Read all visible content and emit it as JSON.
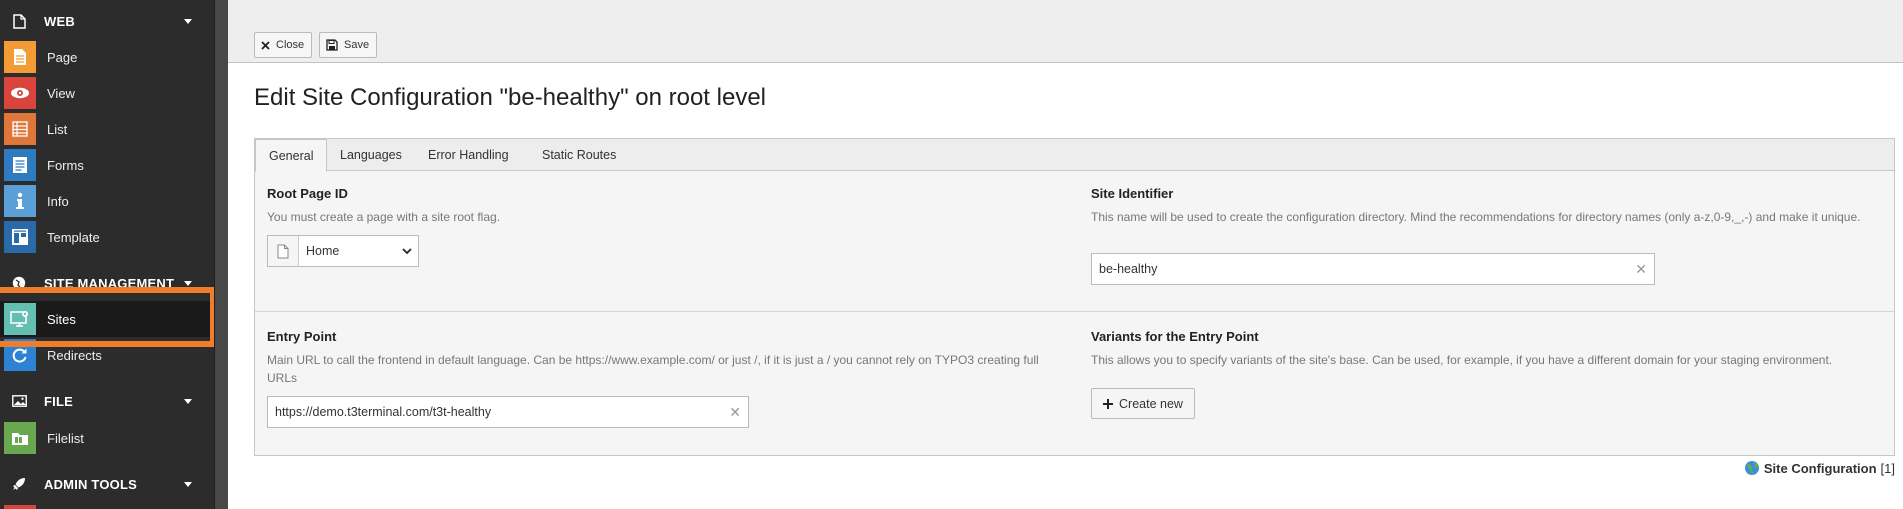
{
  "sidebar": {
    "groups": {
      "web": "WEB",
      "site_management": "SITE MANAGEMENT",
      "file": "FILE",
      "admin_tools": "ADMIN TOOLS"
    },
    "modules": {
      "page": "Page",
      "view": "View",
      "list": "List",
      "forms": "Forms",
      "info": "Info",
      "template": "Template",
      "sites": "Sites",
      "redirects": "Redirects",
      "filelist": "Filelist"
    },
    "active_module": "Sites",
    "colors": {
      "page": "#f39c36",
      "view": "#d9453d",
      "list": "#e0773a",
      "forms": "#2f7bbf",
      "info": "#5a9fd6",
      "template": "#2a6aa8",
      "sites": "#62bfb1",
      "redirects": "#2d82d4",
      "filelist": "#6aa84f",
      "highlight": "#ef7d2b"
    }
  },
  "toolbar": {
    "close_label": "Close",
    "save_label": "Save"
  },
  "main": {
    "title": "Edit Site Configuration \"be-healthy\" on root level",
    "tabs": [
      "General",
      "Languages",
      "Error Handling",
      "Static Routes"
    ],
    "active_tab": "General",
    "fields": {
      "root_page_id": {
        "label": "Root Page ID",
        "description": "You must create a page with a site root flag.",
        "value": "Home"
      },
      "site_identifier": {
        "label": "Site Identifier",
        "description": "This name will be used to create the configuration directory. Mind the recommendations for directory names (only a-z,0-9,_,-) and make it unique.",
        "value": "be-healthy"
      },
      "entry_point": {
        "label": "Entry Point",
        "description": "Main URL to call the frontend in default language. Can be https://www.example.com/ or just /, if it is just a / you cannot rely on TYPO3 creating full URLs",
        "value": "https://demo.t3terminal.com/t3t-healthy"
      },
      "variants": {
        "label": "Variants for the Entry Point",
        "description": "This allows you to specify variants of the site's base. Can be used, for example, if you have a different domain for your staging environment.",
        "button_label": "Create new"
      }
    },
    "footer": {
      "label": "Site Configuration",
      "count": "[1]"
    }
  }
}
